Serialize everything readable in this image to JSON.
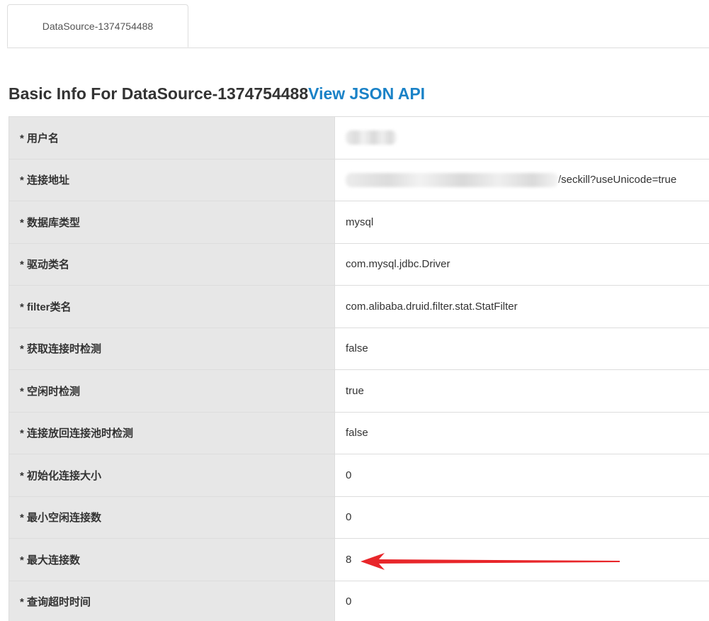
{
  "tabs": [
    {
      "label": "DataSource-1374754488"
    }
  ],
  "heading": {
    "title": "Basic Info For DataSource-1374754488",
    "link_label": "View JSON API"
  },
  "rows": [
    {
      "key": "* 用户名",
      "value": ""
    },
    {
      "key": "* 连接地址",
      "value": "/seckill?useUnicode=true"
    },
    {
      "key": "* 数据库类型",
      "value": "mysql"
    },
    {
      "key": "* 驱动类名",
      "value": "com.mysql.jdbc.Driver"
    },
    {
      "key": "* filter类名",
      "value": "com.alibaba.druid.filter.stat.StatFilter"
    },
    {
      "key": "* 获取连接时检测",
      "value": "false"
    },
    {
      "key": "* 空闲时检测",
      "value": "true"
    },
    {
      "key": "* 连接放回连接池时检测",
      "value": "false"
    },
    {
      "key": "* 初始化连接大小",
      "value": "0"
    },
    {
      "key": "* 最小空闲连接数",
      "value": "0"
    },
    {
      "key": "* 最大连接数",
      "value": "8"
    },
    {
      "key": "* 查询超时时间",
      "value": "0"
    }
  ],
  "colors": {
    "link": "#1a82c7",
    "key_background": "#e7e7e7",
    "border": "#dddddd",
    "arrow": "#e8262a"
  },
  "annotation": {
    "icon": "red-arrow-icon"
  }
}
